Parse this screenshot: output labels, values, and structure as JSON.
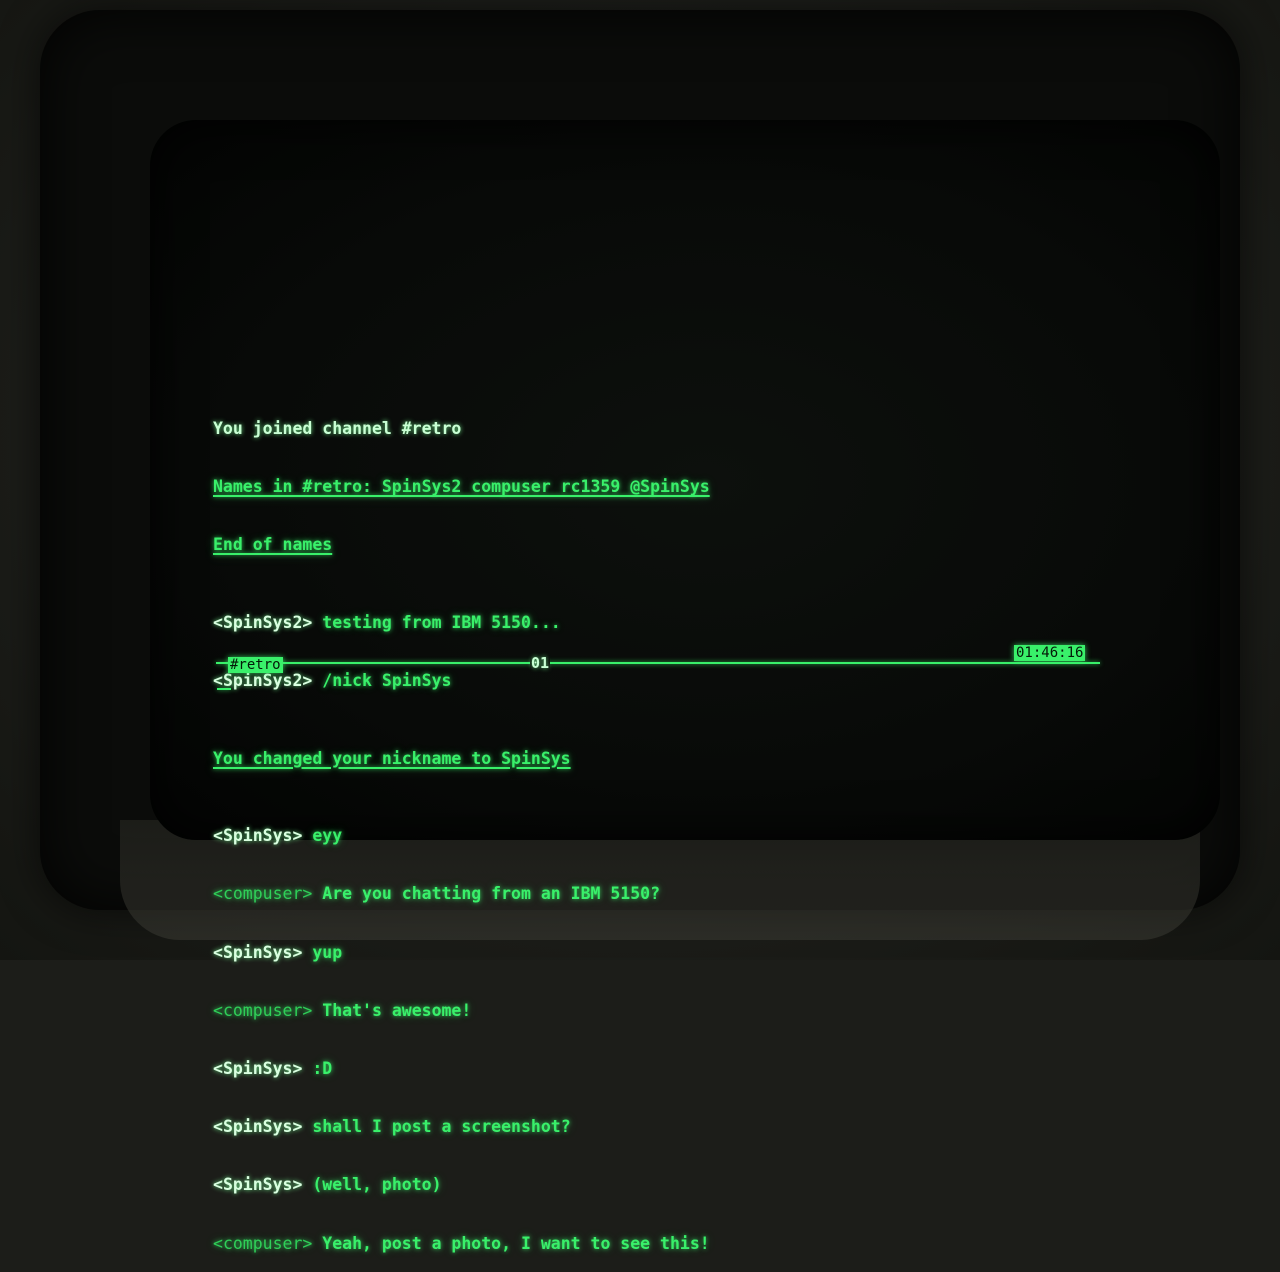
{
  "chat": {
    "joined": "You joined channel #retro",
    "names": "Names in #retro: SpinSys2 compuser rc1359 @SpinSys",
    "end_names": "End of names",
    "messages": [
      {
        "nick": "SpinSys2",
        "text": "testing from IBM 5150..."
      },
      {
        "nick": "SpinSys2",
        "text": "/nick SpinSys"
      },
      {
        "nick": "",
        "text": ""
      },
      {
        "nick": "SpinSys",
        "text": "eyy"
      },
      {
        "nick": "compuser",
        "text": "Are you chatting from an IBM 5150?"
      },
      {
        "nick": "SpinSys",
        "text": "yup"
      },
      {
        "nick": "compuser",
        "text": "That's awesome!"
      },
      {
        "nick": "SpinSys",
        "text": ":D"
      },
      {
        "nick": "SpinSys",
        "text": "shall I post a screenshot?"
      },
      {
        "nick": "SpinSys",
        "text": "(well, photo)"
      },
      {
        "nick": "compuser",
        "text": "Yeah, post a photo, I want to see this!"
      }
    ],
    "nick_changed": "You changed your nickname to SpinSys"
  },
  "status": {
    "channel": "#retro",
    "window": "01",
    "clock": "01:46:16"
  },
  "colors": {
    "phosphor": "#39f06a",
    "screen": "#080a08"
  }
}
